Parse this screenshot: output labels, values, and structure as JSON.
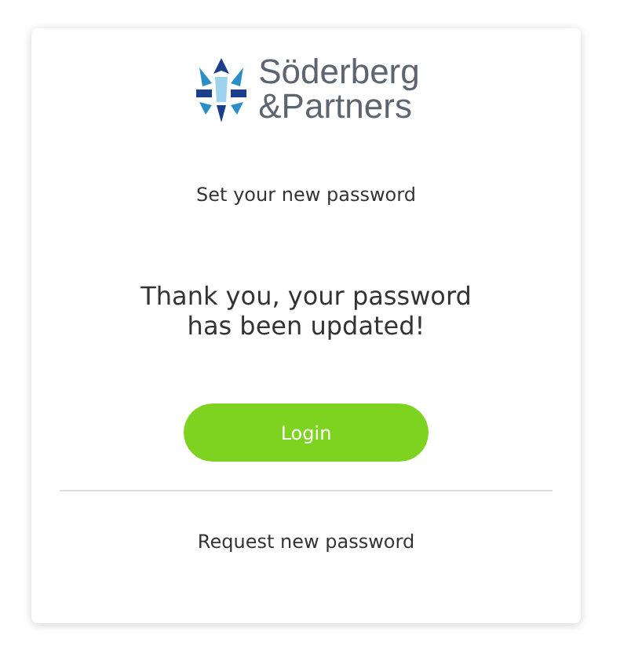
{
  "logo": {
    "line_1": "Söderberg",
    "line_2": "&Partners"
  },
  "heading": "Set your new password",
  "message": "Thank you, your password has been updated!",
  "login_button": "Login",
  "request_link": "Request new password"
}
